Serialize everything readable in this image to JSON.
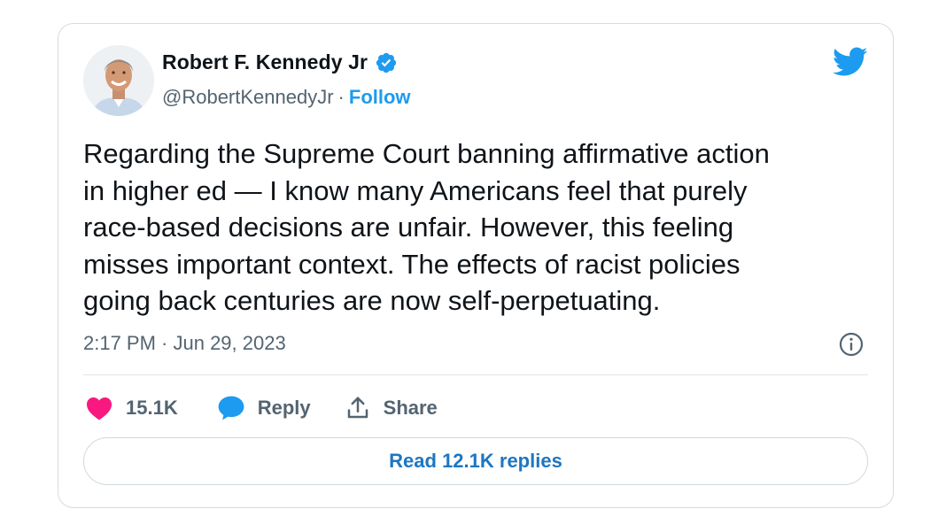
{
  "author": {
    "display_name": "Robert F. Kennedy Jr",
    "handle": "@RobertKennedyJr",
    "separator": "·",
    "follow_label": "Follow",
    "verified": true
  },
  "tweet": {
    "text": "Regarding the Supreme Court banning affirmative action\nin higher ed — I know many Americans feel that purely\nrace-based decisions are unfair. However, this feeling\nmisses important context. The effects of racist policies\ngoing back centuries are now self-perpetuating.",
    "timestamp": "2:17 PM · Jun 29, 2023"
  },
  "actions": {
    "likes_count": "15.1K",
    "reply_label": "Reply",
    "share_label": "Share"
  },
  "replies_button": {
    "label": "Read 12.1K replies"
  },
  "icons": {
    "brand": "twitter-bird-icon",
    "verified": "verified-badge-icon",
    "info": "info-icon",
    "like": "heart-icon",
    "reply": "speech-bubble-icon",
    "share": "share-upload-icon"
  },
  "colors": {
    "brand_blue": "#1d9bf0",
    "like_pink": "#f91880",
    "text_primary": "#0f1419",
    "text_secondary": "#536471",
    "link_blue": "#1d76c2"
  }
}
